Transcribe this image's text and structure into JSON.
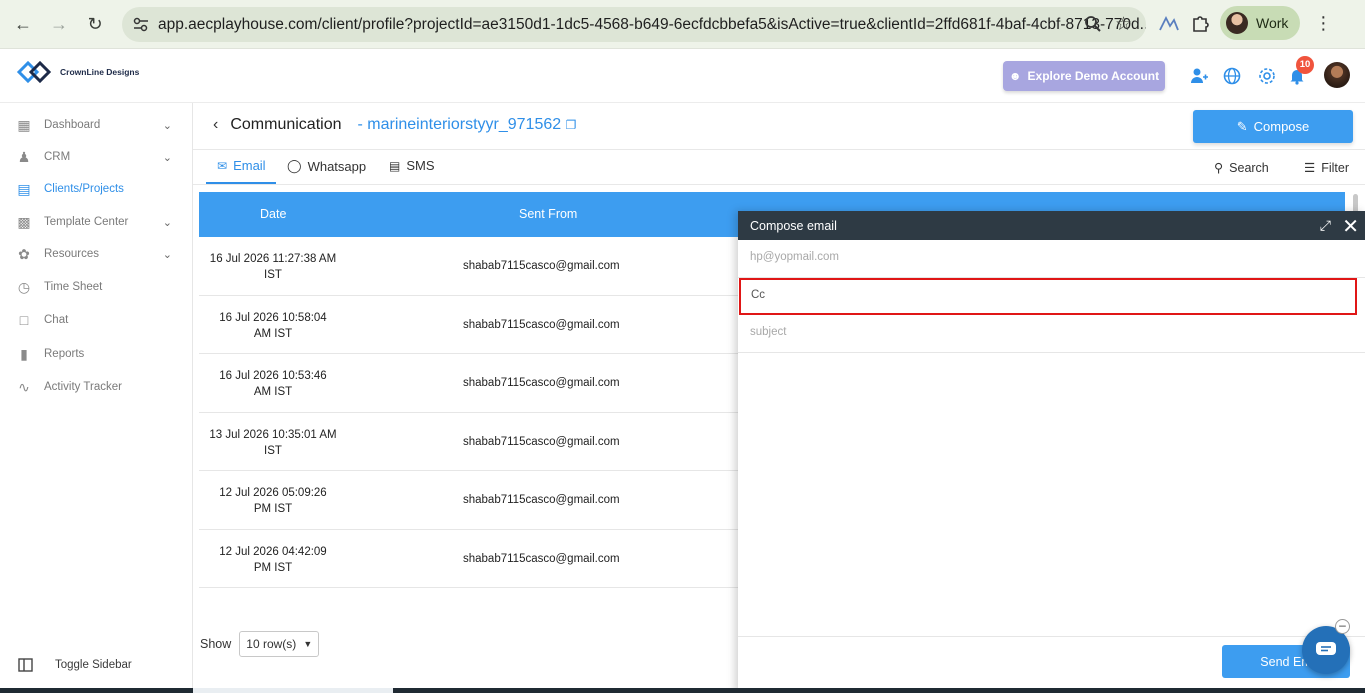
{
  "browser": {
    "url": "app.aecplayhouse.com/client/profile?projectId=ae3150d1-1dc5-4568-b649-6ecfdcbbefa5&isActive=true&clientId=2ffd681f-4baf-4cbf-8713-770d...",
    "profile_label": "Work"
  },
  "header": {
    "logo_text": "CrownLine Designs",
    "demo_button": "Explore Demo Account",
    "notification_count": "10"
  },
  "sidebar": {
    "items": [
      {
        "label": "Dashboard",
        "icon": "dashboard-icon",
        "has_chevron": true
      },
      {
        "label": "CRM",
        "icon": "users-icon",
        "has_chevron": true
      },
      {
        "label": "Clients/Projects",
        "icon": "clients-icon",
        "has_chevron": false,
        "active": true
      },
      {
        "label": "Template Center",
        "icon": "template-icon",
        "has_chevron": true
      },
      {
        "label": "Resources",
        "icon": "resources-icon",
        "has_chevron": true
      },
      {
        "label": "Time Sheet",
        "icon": "clock-icon",
        "has_chevron": false
      },
      {
        "label": "Chat",
        "icon": "chat-icon",
        "has_chevron": false
      },
      {
        "label": "Reports",
        "icon": "chart-icon",
        "has_chevron": false
      },
      {
        "label": "Activity Tracker",
        "icon": "activity-icon",
        "has_chevron": false
      }
    ],
    "toggle_label": "Toggle Sidebar"
  },
  "main": {
    "title": "Communication",
    "separator": "-",
    "project_name": "marineinteriorstyyr_971562",
    "compose_label": "Compose",
    "tabs": [
      {
        "label": "Email",
        "active": true
      },
      {
        "label": "Whatsapp"
      },
      {
        "label": "SMS"
      }
    ],
    "search_label": "Search",
    "filter_label": "Filter",
    "table": {
      "headers": [
        "Date",
        "Sent From"
      ],
      "rows": [
        {
          "date_line1": "16 Jul 2026 11:27:38 AM",
          "date_line2": "IST",
          "from": "shabab7115casco@gmail.com"
        },
        {
          "date_line1": "16 Jul 2026 10:58:04",
          "date_line2": "AM IST",
          "from": "shabab7115casco@gmail.com"
        },
        {
          "date_line1": "16 Jul 2026 10:53:46",
          "date_line2": "AM IST",
          "from": "shabab7115casco@gmail.com"
        },
        {
          "date_line1": "13 Jul 2026 10:35:01 AM",
          "date_line2": "IST",
          "from": "shabab7115casco@gmail.com"
        },
        {
          "date_line1": "12 Jul 2026 05:09:26",
          "date_line2": "PM IST",
          "from": "shabab7115casco@gmail.com"
        },
        {
          "date_line1": "12 Jul 2026 04:42:09",
          "date_line2": "PM IST",
          "from": "shabab7115casco@gmail.com"
        }
      ]
    },
    "show_label": "Show",
    "rows_select": "10 row(s)"
  },
  "compose": {
    "title": "Compose email",
    "to_value": "hp@yopmail.com",
    "cc_placeholder": "Cc",
    "subject_placeholder": "subject",
    "send_label": "Send Em"
  },
  "colors": {
    "accent": "#3d9df0",
    "compose_header": "#2e3a44",
    "highlight": "#e01616"
  }
}
